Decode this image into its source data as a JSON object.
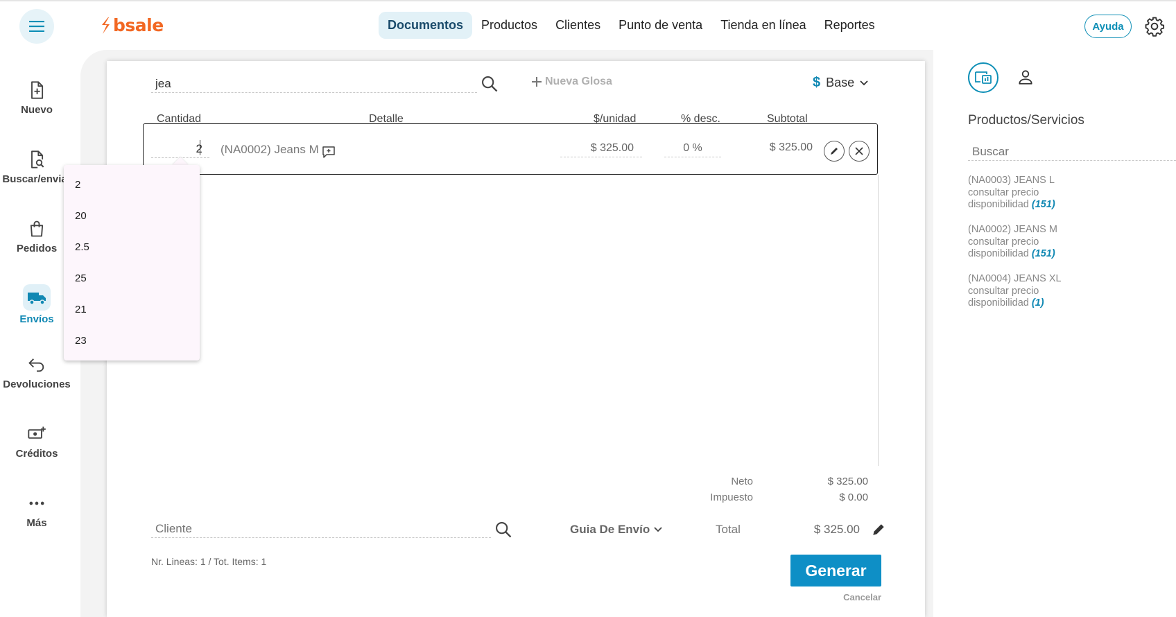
{
  "header": {
    "brand": "bsale",
    "nav": [
      {
        "label": "Documentos",
        "active": true
      },
      {
        "label": "Productos",
        "active": false
      },
      {
        "label": "Clientes",
        "active": false
      },
      {
        "label": "Punto de venta",
        "active": false
      },
      {
        "label": "Tienda en línea",
        "active": false
      },
      {
        "label": "Reportes",
        "active": false
      }
    ],
    "help_label": "Ayuda"
  },
  "sidebar": {
    "items": [
      {
        "label": "Nuevo",
        "icon": "file-plus-icon"
      },
      {
        "label": "Buscar/enviar",
        "icon": "file-search-icon"
      },
      {
        "label": "Pedidos",
        "icon": "shopping-bag-icon"
      },
      {
        "label": "Envíos",
        "icon": "truck-icon",
        "active": true
      },
      {
        "label": "Devoluciones",
        "icon": "return-arrow-icon"
      },
      {
        "label": "Créditos",
        "icon": "money-plus-icon"
      },
      {
        "label": "Más",
        "icon": "more-dots-icon"
      }
    ]
  },
  "document": {
    "search_value": "jea",
    "new_gloss_label": "Nueva Glosa",
    "currency_symbol": "$",
    "price_list": "Base",
    "columns": {
      "quantity": "Cantidad",
      "detail": "Detalle",
      "unit_price": "$/unidad",
      "discount": "% desc.",
      "subtotal": "Subtotal"
    },
    "row": {
      "quantity": "2",
      "detail": "(NA0002) Jeans M",
      "unit_price": "$ 325.00",
      "discount": "0 %",
      "subtotal": "$ 325.00"
    },
    "quantity_suggestions": [
      "2",
      "20",
      "2.5",
      "25",
      "21",
      "23"
    ],
    "totals": {
      "neto_label": "Neto",
      "neto_value": "$ 325.00",
      "impuesto_label": "Impuesto",
      "impuesto_value": "$ 0.00",
      "total_label": "Total",
      "total_value": "$ 325.00"
    },
    "client_placeholder": "Cliente",
    "doc_type": "Guia De Envío",
    "summary": "Nr. Lineas: 1 / Tot. Items: 1",
    "generate_label": "Generar",
    "cancel_label": "Cancelar"
  },
  "right_panel": {
    "title": "Productos/Servicios",
    "search_placeholder": "Buscar",
    "products": [
      {
        "name": "(NA0003) JEANS L",
        "price": "consultar precio",
        "availability_label": "disponibilidad",
        "stock": "(151)"
      },
      {
        "name": "(NA0002) JEANS M",
        "price": "consultar precio",
        "availability_label": "disponibilidad",
        "stock": "(151)"
      },
      {
        "name": "(NA0004) JEANS XL",
        "price": "consultar precio",
        "availability_label": "disponibilidad",
        "stock": "(1)"
      }
    ]
  },
  "colors": {
    "accent": "#0e8fb6",
    "brand": "#f26722",
    "primary_button": "#0e8fc6"
  }
}
